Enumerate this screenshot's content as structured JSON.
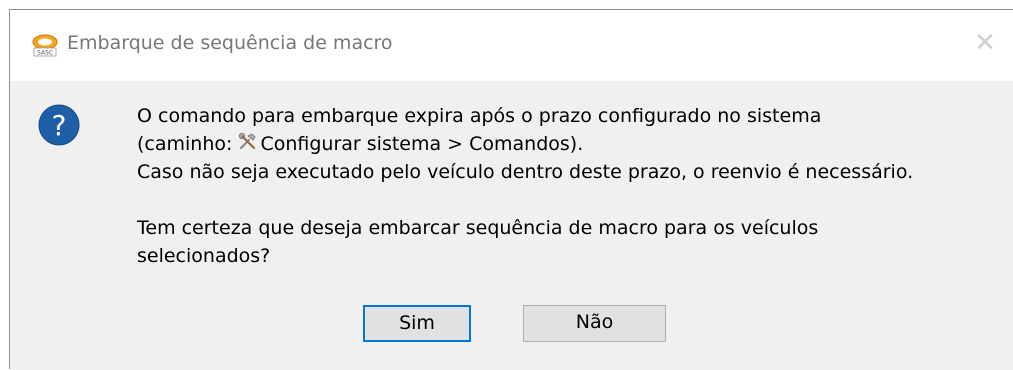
{
  "window": {
    "title": "Embarque de sequência de macro",
    "app_icon": "saga-logo-icon",
    "close_icon": "close-icon"
  },
  "message": {
    "icon": "question-icon",
    "line1": "O comando para embarque expira após o prazo configurado no sistema",
    "line2_prefix": "(caminho: ",
    "line2_icon": "tools-icon",
    "line2_path": "Configurar sistema > Comandos).",
    "line3": "Caso não seja executado pelo veículo dentro deste prazo, o reenvio é necessário.",
    "line4": "Tem certeza que deseja embarcar sequência de macro para os veículos",
    "line5": "selecionados?"
  },
  "buttons": {
    "yes_label": "Sim",
    "no_label": "Não"
  },
  "colors": {
    "accent": "#0078d7",
    "question_icon": "#1f5fa8",
    "content_bg": "#f0f0f0"
  }
}
